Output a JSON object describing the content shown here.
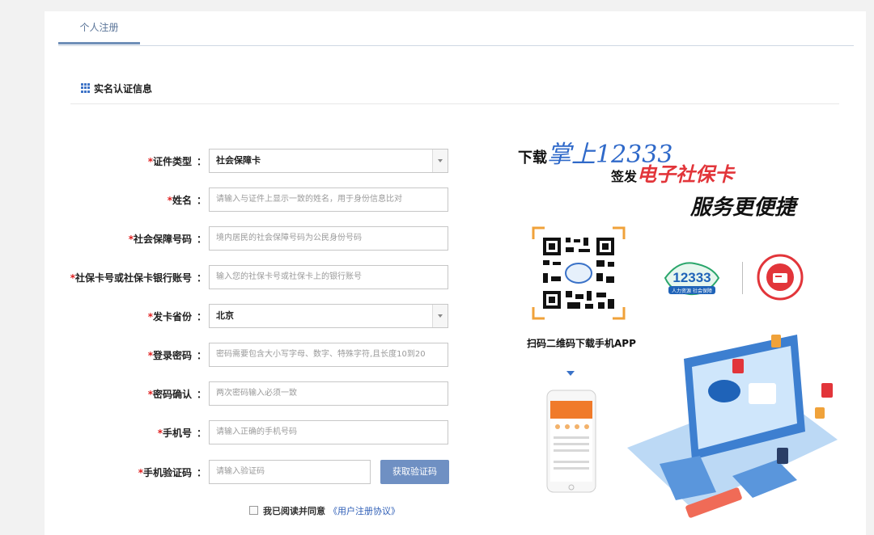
{
  "tabs": [
    {
      "label": "个人注册",
      "active": true
    }
  ],
  "section": {
    "title": "实名认证信息"
  },
  "form": {
    "fields": [
      {
        "label": "证件类型",
        "value": "社会保障卡",
        "placeholder": "",
        "type": "select"
      },
      {
        "label": "姓名",
        "value": "",
        "placeholder": "请输入与证件上显示一致的姓名，用于身份信息比对",
        "type": "input"
      },
      {
        "label": "社会保障号码",
        "value": "",
        "placeholder": "境内居民的社会保障号码为公民身份号码",
        "type": "input"
      },
      {
        "label": "社保卡号或社保卡银行账号",
        "value": "",
        "placeholder": "输入您的社保卡号或社保卡上的银行账号",
        "type": "input"
      },
      {
        "label": "发卡省份",
        "value": "北京",
        "placeholder": "",
        "type": "select"
      },
      {
        "label": "登录密码",
        "value": "",
        "placeholder": "密码需要包含大小写字母、数字、特殊字符,且长度10到20",
        "type": "input"
      },
      {
        "label": "密码确认",
        "value": "",
        "placeholder": "两次密码输入必须一致",
        "type": "input"
      },
      {
        "label": "手机号",
        "value": "",
        "placeholder": "请输入正确的手机号码",
        "type": "input"
      },
      {
        "label": "手机验证码",
        "value": "",
        "placeholder": "请输入验证码",
        "type": "input"
      }
    ],
    "get_code_button": "获取验证码",
    "agreement": {
      "text": "我已阅读并同意",
      "link": "《用户注册协议》",
      "checked": false
    }
  },
  "promo": {
    "line1_prefix": "下载",
    "line1_brand": "掌上",
    "line1_number": "12333",
    "line2_prefix": "签发",
    "line2_product": "电子社保卡",
    "line3": "服务更便捷",
    "qr_caption": "扫码二维码下载手机APP",
    "logo_number": "12333",
    "logo_caption": "人力资源 社会保障"
  },
  "colors": {
    "accent": "#6f90c3",
    "required": "#e02020",
    "link": "#2f5fb7",
    "brand_red": "#e2353a"
  }
}
